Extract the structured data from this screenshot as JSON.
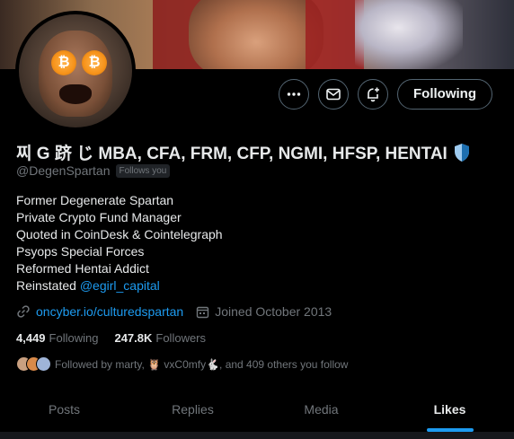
{
  "profile": {
    "display_name": "찌 G 跻 じ MBA, CFA, FRM, CFP, NGMI, HFSP, HENTAI",
    "handle": "@DegenSpartan",
    "follows_you": "Follows you",
    "bio_lines": [
      "Former Degenerate Spartan",
      "Private Crypto Fund Manager",
      "Quoted in CoinDesk & Cointelegraph",
      "Psyops Special Forces",
      "Reformed Hentai Addict"
    ],
    "reinstated_prefix": "Reinstated",
    "reinstated_link": "@egirl_capital",
    "website": "oncyber.io/culturedspartan",
    "joined": "Joined October 2013",
    "following_count": "4,449",
    "following_label": "Following",
    "followers_count": "247.8K",
    "followers_label": "Followers",
    "followed_by": "Followed by marty, 🦉 vxC0mfy🐇, and 409 others you follow"
  },
  "actions": {
    "follow_button": "Following",
    "more_icon": "more-icon",
    "message_icon": "mail-icon",
    "notify_icon": "bell-plus-icon"
  },
  "tabs": [
    {
      "label": "Posts"
    },
    {
      "label": "Replies"
    },
    {
      "label": "Media"
    },
    {
      "label": "Likes",
      "active": true
    }
  ],
  "colors": {
    "accent": "#1d9bf0",
    "background": "#000000",
    "muted": "#71767b",
    "text": "#e7e9ea"
  }
}
